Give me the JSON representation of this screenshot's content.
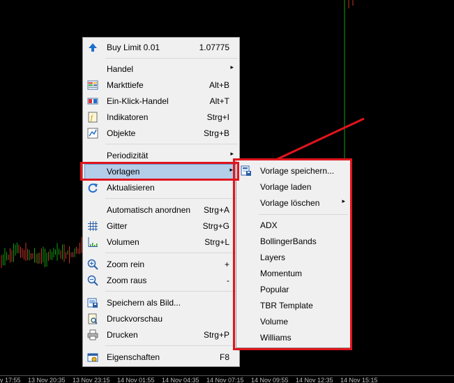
{
  "time_axis": [
    "y 17:55",
    "13 Nov 20:35",
    "13 Nov 23:15",
    "14 Nov 01:55",
    "14 Nov 04:35",
    "14 Nov 07:15",
    "14 Nov 09:55",
    "14 Nov 12:35",
    "14 Nov 15:15"
  ],
  "context_menu": {
    "items": [
      {
        "label": "Buy Limit 0.01",
        "shortcut": "1.07775",
        "icon": "buy-limit-arrow-icon"
      },
      {
        "label": "Handel",
        "shortcut": "",
        "icon": "",
        "submenu": true
      },
      {
        "label": "Markttiefe",
        "shortcut": "Alt+B",
        "icon": "market-depth-icon"
      },
      {
        "label": "Ein-Klick-Handel",
        "shortcut": "Alt+T",
        "icon": "one-click-trading-icon"
      },
      {
        "label": "Indikatoren",
        "shortcut": "Strg+I",
        "icon": "indicators-icon"
      },
      {
        "label": "Objekte",
        "shortcut": "Strg+B",
        "icon": "objects-icon"
      },
      {
        "label": "Periodizität",
        "shortcut": "",
        "icon": "",
        "submenu": true
      },
      {
        "label": "Vorlagen",
        "shortcut": "",
        "icon": "",
        "submenu": true
      },
      {
        "label": "Aktualisieren",
        "shortcut": "",
        "icon": "refresh-icon"
      },
      {
        "label": "Automatisch anordnen",
        "shortcut": "Strg+A",
        "icon": ""
      },
      {
        "label": "Gitter",
        "shortcut": "Strg+G",
        "icon": "grid-icon"
      },
      {
        "label": "Volumen",
        "shortcut": "Strg+L",
        "icon": "volumes-icon"
      },
      {
        "label": "Zoom rein",
        "shortcut": "+",
        "icon": "zoom-in-icon"
      },
      {
        "label": "Zoom raus",
        "shortcut": "-",
        "icon": "zoom-out-icon"
      },
      {
        "label": "Speichern als Bild...",
        "shortcut": "",
        "icon": "save-picture-icon"
      },
      {
        "label": "Druckvorschau",
        "shortcut": "",
        "icon": "print-preview-icon"
      },
      {
        "label": "Drucken",
        "shortcut": "Strg+P",
        "icon": "print-icon"
      },
      {
        "label": "Eigenschaften",
        "shortcut": "F8",
        "icon": "properties-icon"
      }
    ]
  },
  "submenu": {
    "items": [
      {
        "label": "Vorlage speichern...",
        "icon": "save-template-icon"
      },
      {
        "label": "Vorlage laden"
      },
      {
        "label": "Vorlage löschen",
        "submenu": true
      },
      {
        "label": "ADX"
      },
      {
        "label": "BollingerBands"
      },
      {
        "label": "Layers"
      },
      {
        "label": "Momentum"
      },
      {
        "label": "Popular"
      },
      {
        "label": "TBR Template"
      },
      {
        "label": "Volume"
      },
      {
        "label": "Williams"
      }
    ]
  },
  "colors": {
    "annotation": "#e0141c",
    "menu_bg": "#f0f0f0",
    "highlight": "#b4cde8",
    "bull_bar": "#0f9f0f",
    "bear_bar": "#c0392b"
  }
}
